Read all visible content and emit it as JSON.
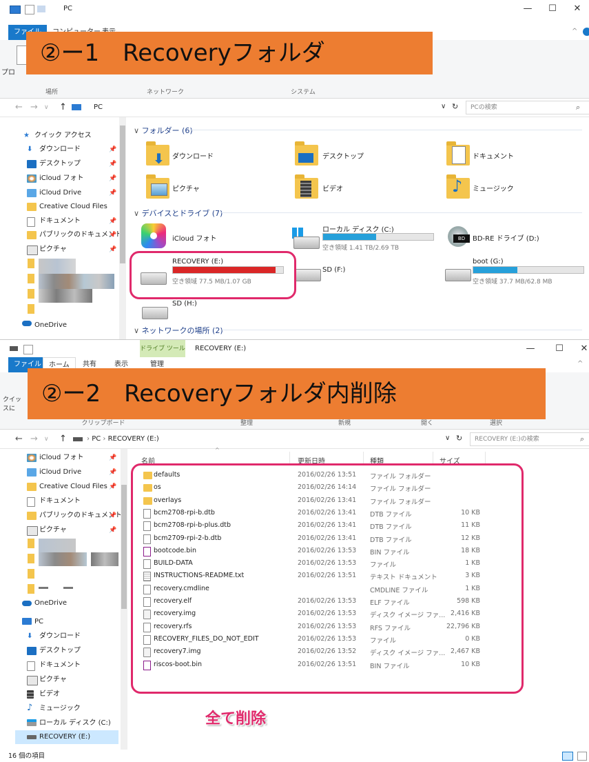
{
  "window1": {
    "title": "PC",
    "tabs": [
      "ファイル",
      "コンピューター",
      "表示"
    ],
    "ribbon_groups": [
      "場所",
      "ネットワーク",
      "システム"
    ],
    "ribbon_left_label": "プロ",
    "address_path": "PC",
    "search_placeholder": "PCの検索",
    "sidebar": {
      "quick_access": "クイック アクセス",
      "items": [
        {
          "label": "ダウンロード",
          "icon": "download-arrow-icon"
        },
        {
          "label": "デスクトップ",
          "icon": "desktop-icon"
        },
        {
          "label": "iCloud フォト",
          "icon": "icloud-photos-icon"
        },
        {
          "label": "iCloud Drive",
          "icon": "icloud-drive-icon"
        },
        {
          "label": "Creative Cloud Files",
          "icon": "folder-icon"
        },
        {
          "label": "ドキュメント",
          "icon": "documents-icon"
        },
        {
          "label": "パブリックのドキュメント",
          "icon": "folder-icon"
        },
        {
          "label": "ピクチャ",
          "icon": "pictures-icon"
        }
      ],
      "onedrive": "OneDrive"
    },
    "folders_header": "フォルダー (6)",
    "folders": [
      "ダウンロード",
      "デスクトップ",
      "ドキュメント",
      "ピクチャ",
      "ビデオ",
      "ミュージック"
    ],
    "devices_header": "デバイスとドライブ (7)",
    "drives": [
      {
        "name": "iCloud フォト",
        "free": ""
      },
      {
        "name": "ローカル ディスク (C:)",
        "free": "空き領域 1.41 TB/2.69 TB",
        "fill": 0.48,
        "color": "#26a0da"
      },
      {
        "name": "BD-RE ドライブ (D:)",
        "free": ""
      },
      {
        "name": "RECOVERY (E:)",
        "free": "空き領域 77.5 MB/1.07 GB",
        "fill": 0.93,
        "color": "#da2626"
      },
      {
        "name": "SD (F:)",
        "free": ""
      },
      {
        "name": "boot (G:)",
        "free": "空き領域 37.7 MB/62.8 MB",
        "fill": 0.4,
        "color": "#26a0da"
      },
      {
        "name": "SD (H:)",
        "free": ""
      }
    ],
    "network_header": "ネットワークの場所 (2)"
  },
  "banner1": "②ー1　Recoveryフォルダ",
  "window2": {
    "context_tab": "ドライブ ツール",
    "title": "RECOVERY (E:)",
    "tabs": [
      "ファイル",
      "ホーム",
      "共有",
      "表示",
      "管理"
    ],
    "ribbon_left_label": "クイッ\nスに",
    "ribbon_groups": [
      "クリップボード",
      "整理",
      "新規",
      "開く",
      "選択"
    ],
    "breadcrumb": [
      "PC",
      "RECOVERY (E:)"
    ],
    "search_placeholder": "RECOVERY (E:)の検索",
    "sidebar_items": [
      "iCloud フォト",
      "iCloud Drive",
      "Creative Cloud Files",
      "ドキュメント",
      "パブリックのドキュメント",
      "ピクチャ"
    ],
    "onedrive": "OneDrive",
    "pc": "PC",
    "pc_items": [
      "ダウンロード",
      "デスクトップ",
      "ドキュメント",
      "ピクチャ",
      "ビデオ",
      "ミュージック",
      "ローカル ディスク (C:)",
      "RECOVERY (E:)"
    ],
    "columns": [
      "名前",
      "更新日時",
      "種類",
      "サイズ"
    ],
    "files": [
      {
        "name": "defaults",
        "date": "2016/02/26 13:51",
        "type": "ファイル フォルダー",
        "size": "",
        "icon": "folder"
      },
      {
        "name": "os",
        "date": "2016/02/26 14:14",
        "type": "ファイル フォルダー",
        "size": "",
        "icon": "folder"
      },
      {
        "name": "overlays",
        "date": "2016/02/26 13:41",
        "type": "ファイル フォルダー",
        "size": "",
        "icon": "folder"
      },
      {
        "name": "bcm2708-rpi-b.dtb",
        "date": "2016/02/26 13:41",
        "type": "DTB ファイル",
        "size": "10 KB",
        "icon": "file"
      },
      {
        "name": "bcm2708-rpi-b-plus.dtb",
        "date": "2016/02/26 13:41",
        "type": "DTB ファイル",
        "size": "11 KB",
        "icon": "file"
      },
      {
        "name": "bcm2709-rpi-2-b.dtb",
        "date": "2016/02/26 13:41",
        "type": "DTB ファイル",
        "size": "12 KB",
        "icon": "file"
      },
      {
        "name": "bootcode.bin",
        "date": "2016/02/26 13:53",
        "type": "BIN ファイル",
        "size": "18 KB",
        "icon": "bin"
      },
      {
        "name": "BUILD-DATA",
        "date": "2016/02/26 13:53",
        "type": "ファイル",
        "size": "1 KB",
        "icon": "file"
      },
      {
        "name": "INSTRUCTIONS-README.txt",
        "date": "2016/02/26 13:51",
        "type": "テキスト ドキュメント",
        "size": "3 KB",
        "icon": "txt"
      },
      {
        "name": "recovery.cmdline",
        "date": "",
        "type": "CMDLINE ファイル",
        "size": "1 KB",
        "icon": "file"
      },
      {
        "name": "recovery.elf",
        "date": "2016/02/26 13:53",
        "type": "ELF ファイル",
        "size": "598 KB",
        "icon": "file"
      },
      {
        "name": "recovery.img",
        "date": "2016/02/26 13:53",
        "type": "ディスク イメージ ファ...",
        "size": "2,416 KB",
        "icon": "img"
      },
      {
        "name": "recovery.rfs",
        "date": "2016/02/26 13:53",
        "type": "RFS ファイル",
        "size": "22,796 KB",
        "icon": "file"
      },
      {
        "name": "RECOVERY_FILES_DO_NOT_EDIT",
        "date": "2016/02/26 13:53",
        "type": "ファイル",
        "size": "0 KB",
        "icon": "file"
      },
      {
        "name": "recovery7.img",
        "date": "2016/02/26 13:52",
        "type": "ディスク イメージ ファ...",
        "size": "2,467 KB",
        "icon": "img"
      },
      {
        "name": "riscos-boot.bin",
        "date": "2016/02/26 13:51",
        "type": "BIN ファイル",
        "size": "10 KB",
        "icon": "bin"
      }
    ],
    "status": "16 個の項目"
  },
  "banner2": "②ー2　Recoveryフォルダ内削除",
  "annotation": "全て削除"
}
